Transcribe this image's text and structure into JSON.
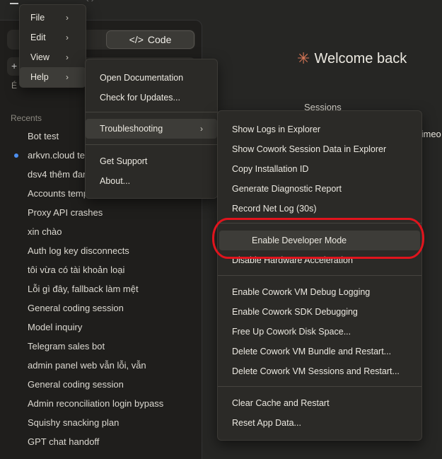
{
  "app": {
    "nav_arrows": "‹ ›"
  },
  "sidebar": {
    "mode_tab_code": "Code",
    "code_icon": "code-brackets-icon",
    "new_glyph": "+",
    "aux_glyph": "É",
    "recents_heading": "Recents",
    "recents": [
      {
        "label": "Bot test",
        "active": false
      },
      {
        "label": "arkvn.cloud te",
        "active": true
      },
      {
        "label": "dsv4 thêm đan",
        "active": false
      },
      {
        "label": "Accounts temp",
        "active": false
      },
      {
        "label": "Proxy API crashes",
        "active": false
      },
      {
        "label": "xin chào",
        "active": false
      },
      {
        "label": "Auth log key disconnects",
        "active": false
      },
      {
        "label": "tôi vừa có tài khoản loại",
        "active": false
      },
      {
        "label": "Lỗi gì đây, fallback làm mệt",
        "active": false
      },
      {
        "label": "General coding session",
        "active": false
      },
      {
        "label": "Model inquiry",
        "active": false
      },
      {
        "label": "Telegram sales bot",
        "active": false
      },
      {
        "label": "admin panel web vẫn lỗi, vẫn",
        "active": false
      },
      {
        "label": "General coding session",
        "active": false
      },
      {
        "label": "Admin reconciliation login bypass",
        "active": false
      },
      {
        "label": "Squishy snacking plan",
        "active": false
      },
      {
        "label": "GPT chat handoff",
        "active": false
      }
    ]
  },
  "main": {
    "welcome": "Welcome back",
    "welcome_icon": "sparkle-icon",
    "sessions_label": "Sessions",
    "partial_text": "timeo"
  },
  "menus": {
    "main": [
      "File",
      "Edit",
      "View",
      "Help"
    ],
    "help": {
      "group1": [
        "Open Documentation",
        "Check for Updates..."
      ],
      "troubleshooting": "Troubleshooting",
      "group3": [
        "Get Support",
        "About..."
      ]
    },
    "troubleshooting": {
      "group1": [
        "Show Logs in Explorer",
        "Show Cowork Session Data in Explorer",
        "Copy Installation ID",
        "Generate Diagnostic Report",
        "Record Net Log (30s)"
      ],
      "group2": [
        "Enable Developer Mode",
        "Disable Hardware Acceleration"
      ],
      "group3": [
        "Enable Cowork VM Debug Logging",
        "Enable Cowork SDK Debugging",
        "Free Up Cowork Disk Space...",
        "Delete Cowork VM Bundle and Restart...",
        "Delete Cowork VM Sessions and Restart..."
      ],
      "group4": [
        "Clear Cache and Restart",
        "Reset App Data..."
      ]
    }
  },
  "colors": {
    "accent": "#d97757",
    "highlight_ring": "#e0141d",
    "active_dot": "#4d8ff0"
  }
}
